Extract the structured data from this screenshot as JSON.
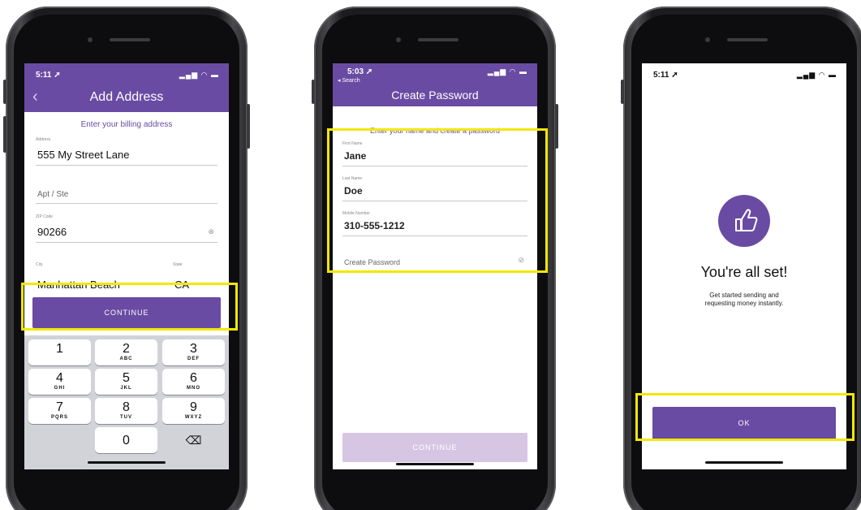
{
  "screen1": {
    "status": {
      "time": "5:11 ➚",
      "icons": "▂▄▆ ◠ ▬"
    },
    "nav": {
      "title": "Add Address",
      "back": "‹"
    },
    "subtitle": "Enter your billing address",
    "fields": {
      "address": {
        "label": "Address",
        "value": "555 My Street Lane"
      },
      "apt": {
        "placeholder": "Apt / Ste"
      },
      "zip": {
        "label": "ZIP Code",
        "value": "90266",
        "clear_icon": "⊗"
      },
      "city": {
        "label": "City",
        "value": "Manhattan Beach"
      },
      "state": {
        "label": "State",
        "value": "CA"
      }
    },
    "continue_label": "CONTINUE",
    "keys": [
      {
        "num": "1",
        "letters": ""
      },
      {
        "num": "2",
        "letters": "ABC"
      },
      {
        "num": "3",
        "letters": "DEF"
      },
      {
        "num": "4",
        "letters": "GHI"
      },
      {
        "num": "5",
        "letters": "JKL"
      },
      {
        "num": "6",
        "letters": "MNO"
      },
      {
        "num": "7",
        "letters": "PQRS"
      },
      {
        "num": "8",
        "letters": "TUV"
      },
      {
        "num": "9",
        "letters": "WXYZ"
      },
      {
        "num": "0",
        "letters": ""
      }
    ],
    "delete_icon": "⌫"
  },
  "screen2": {
    "status": {
      "time": "5:03 ➚",
      "back_small": "◂ Search",
      "icons": "▂▄▆ ◠ ▬"
    },
    "nav": {
      "title": "Create Password"
    },
    "subtitle": "Enter your name and create a password",
    "fields": {
      "first": {
        "label": "First Name",
        "value": "Jane"
      },
      "last": {
        "label": "Last Name",
        "value": "Doe"
      },
      "mobile": {
        "label": "Mobile Number",
        "value": "310-555-1212"
      },
      "password": {
        "placeholder": "Create Password",
        "eye_icon": "⊘"
      }
    },
    "continue_label": "CONTINUE"
  },
  "screen3": {
    "status": {
      "time": "5:11 ➚",
      "icons": "▂▄▆ ◠ ▬"
    },
    "title": "You're all set!",
    "message_line1": "Get started sending and",
    "message_line2": "requesting money instantly.",
    "ok_label": "OK"
  },
  "colors": {
    "accent": "#6a4ba3",
    "highlight": "#f2e800",
    "disabled": "#d6c6e4"
  }
}
